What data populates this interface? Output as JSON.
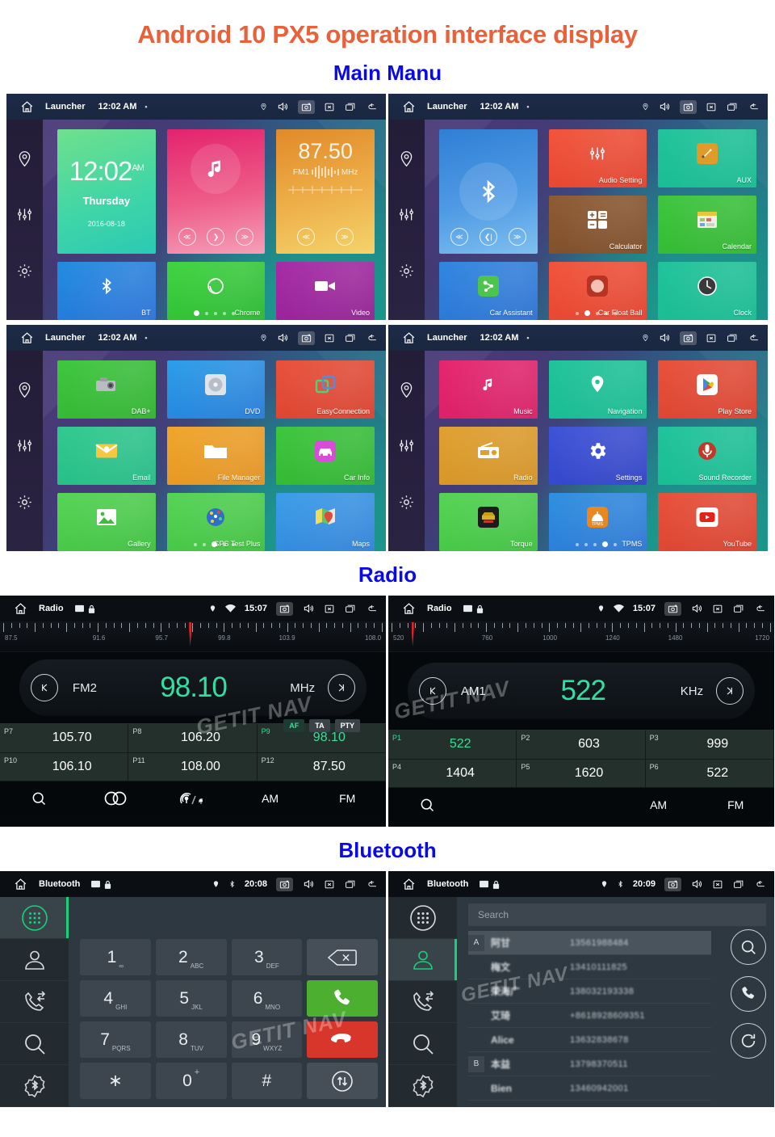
{
  "headings": {
    "main_title": "Android 10 PX5 operation interface display",
    "section_main_menu": "Main Manu",
    "section_radio": "Radio",
    "section_bluetooth": "Bluetooth"
  },
  "watermark": "GETIT NAV",
  "launcher_statusbar": {
    "title": "Launcher",
    "time": "12:02 AM",
    "dot": "•"
  },
  "launcher_panels": [
    {
      "widgets": {
        "clock": {
          "time": "12:02",
          "ampm": "AM",
          "day": "Thursday",
          "date": "2016-08-18"
        },
        "music": {
          "prev": "≪",
          "play": "❯",
          "next": "≫"
        },
        "radio": {
          "freq": "87.50",
          "band": "FM1",
          "unit": "MHz",
          "prev": "≪",
          "next": "≫"
        }
      },
      "tiles": [
        {
          "label": "BT",
          "icon": "bluetooth-icon"
        },
        {
          "label": "Chrome",
          "icon": "chrome-icon"
        },
        {
          "label": "Video",
          "icon": "video-icon"
        }
      ],
      "page_dots": 5,
      "active_dot": 0
    },
    {
      "widgets": {
        "bluetooth": {
          "prev": "≪",
          "play": "❮|",
          "next": "≫"
        }
      },
      "tiles": [
        {
          "label": "Audio Setting",
          "icon": "equalizer-icon"
        },
        {
          "label": "AUX",
          "icon": "aux-icon"
        },
        {
          "label": "Calculator",
          "icon": "calculator-icon"
        },
        {
          "label": "Calendar",
          "icon": "calendar-icon"
        },
        {
          "label": "Car Assistant",
          "icon": "car-assistant-icon"
        },
        {
          "label": "Car Float Ball",
          "icon": "float-ball-icon"
        },
        {
          "label": "Clock",
          "icon": "clock-icon"
        }
      ],
      "page_dots": 5,
      "active_dot": 1
    },
    {
      "tiles": [
        {
          "label": "DAB+",
          "icon": "dab-icon"
        },
        {
          "label": "DVD",
          "icon": "dvd-icon"
        },
        {
          "label": "EasyConnection",
          "icon": "easyconnection-icon"
        },
        {
          "label": "Email",
          "icon": "email-icon"
        },
        {
          "label": "File Manager",
          "icon": "folder-icon"
        },
        {
          "label": "Car Info",
          "icon": "car-info-icon"
        },
        {
          "label": "Gallery",
          "icon": "gallery-icon"
        },
        {
          "label": "GPS Test Plus",
          "icon": "gps-test-icon"
        },
        {
          "label": "Maps",
          "icon": "maps-icon"
        }
      ],
      "page_dots": 5,
      "active_dot": 2
    },
    {
      "tiles": [
        {
          "label": "Music",
          "icon": "music-note-icon"
        },
        {
          "label": "Navigation",
          "icon": "navigation-pin-icon"
        },
        {
          "label": "Play Store",
          "icon": "play-store-icon"
        },
        {
          "label": "Radio",
          "icon": "radio-icon"
        },
        {
          "label": "Settings",
          "icon": "gear-icon"
        },
        {
          "label": "Sound Recorder",
          "icon": "microphone-icon"
        },
        {
          "label": "Torque",
          "icon": "torque-icon"
        },
        {
          "label": "TPMS",
          "icon": "tpms-icon"
        },
        {
          "label": "YouTube",
          "icon": "youtube-icon"
        }
      ],
      "page_dots": 5,
      "active_dot": 3
    }
  ],
  "radio_panels": [
    {
      "statusbar": {
        "title": "Radio",
        "time": "15:07"
      },
      "band": "FM2",
      "value": "98.10",
      "unit": "MHz",
      "scale_labels": [
        "87.5",
        "91.6",
        "95.7",
        "99.8",
        "103.9",
        "108.0"
      ],
      "needle_pct": 49,
      "rds": [
        {
          "label": "AF",
          "active": true
        },
        {
          "label": "TA",
          "active": false
        },
        {
          "label": "PTY",
          "active": false
        }
      ],
      "presets": [
        {
          "id": "P7",
          "value": "105.70",
          "active": false
        },
        {
          "id": "P8",
          "value": "106.20",
          "active": false
        },
        {
          "id": "P9",
          "value": "98.10",
          "active": true
        },
        {
          "id": "P10",
          "value": "106.10",
          "active": false
        },
        {
          "id": "P11",
          "value": "108.00",
          "active": false
        },
        {
          "id": "P12",
          "value": "87.50",
          "active": false
        }
      ],
      "bottom": [
        {
          "label": "",
          "icon": "search-icon"
        },
        {
          "label": "",
          "icon": "stereo-icon"
        },
        {
          "label": "",
          "icon": "local-distance-icon"
        },
        {
          "label": "AM",
          "icon": ""
        },
        {
          "label": "FM",
          "icon": ""
        }
      ]
    },
    {
      "statusbar": {
        "title": "Radio",
        "time": "15:07"
      },
      "band": "AM1",
      "value": "522",
      "unit": "KHz",
      "scale_labels": [
        "520",
        "760",
        "1000",
        "1240",
        "1480",
        "1720"
      ],
      "needle_pct": 6,
      "rds": [],
      "presets": [
        {
          "id": "P1",
          "value": "522",
          "active": true
        },
        {
          "id": "P2",
          "value": "603",
          "active": false
        },
        {
          "id": "P3",
          "value": "999",
          "active": false
        },
        {
          "id": "P4",
          "value": "1404",
          "active": false
        },
        {
          "id": "P5",
          "value": "1620",
          "active": false
        },
        {
          "id": "P6",
          "value": "522",
          "active": false
        }
      ],
      "bottom": [
        {
          "label": "",
          "icon": "search-icon"
        },
        {
          "label": "",
          "icon": ""
        },
        {
          "label": "",
          "icon": ""
        },
        {
          "label": "AM",
          "icon": ""
        },
        {
          "label": "FM",
          "icon": ""
        }
      ]
    }
  ],
  "bluetooth_panels": [
    {
      "statusbar": {
        "title": "Bluetooth",
        "time": "20:08"
      },
      "active_sidebar": 0,
      "sidebar": [
        "dialpad-icon",
        "contacts-icon",
        "call-history-icon",
        "search-icon",
        "bluetooth-settings-icon"
      ],
      "keys": [
        {
          "num": "1",
          "sub": "∞"
        },
        {
          "num": "2",
          "sub": "ABC"
        },
        {
          "num": "3",
          "sub": "DEF"
        },
        {
          "num": "",
          "sub": "",
          "action": "backspace"
        },
        {
          "num": "4",
          "sub": "GHI"
        },
        {
          "num": "5",
          "sub": "JKL"
        },
        {
          "num": "6",
          "sub": "MNO"
        },
        {
          "num": "",
          "sub": "",
          "action": "call"
        },
        {
          "num": "7",
          "sub": "PQRS"
        },
        {
          "num": "8",
          "sub": "TUV"
        },
        {
          "num": "9",
          "sub": "WXYZ"
        },
        {
          "num": "",
          "sub": "",
          "action": "hangup"
        },
        {
          "num": "∗",
          "sub": ""
        },
        {
          "num": "0",
          "sub": "+"
        },
        {
          "num": "#",
          "sub": ""
        },
        {
          "num": "",
          "sub": "",
          "action": "transfer"
        }
      ]
    },
    {
      "statusbar": {
        "title": "Bluetooth",
        "time": "20:09"
      },
      "active_sidebar": 1,
      "sidebar": [
        "dialpad-icon",
        "contacts-icon",
        "call-history-icon",
        "search-icon",
        "bluetooth-settings-icon"
      ],
      "search_placeholder": "Search",
      "contacts": [
        {
          "badge": "A",
          "name": "阿甘",
          "number": "13561988484",
          "selected": true
        },
        {
          "badge": "",
          "name": "梅文",
          "number": "13410111825",
          "selected": false
        },
        {
          "badge": "",
          "name": "荣海广",
          "number": "138032193338",
          "selected": false
        },
        {
          "badge": "",
          "name": "艾琦",
          "number": "+8618928609351",
          "selected": false
        },
        {
          "badge": "",
          "name": "Alice",
          "number": "13632838678",
          "selected": false
        },
        {
          "badge": "B",
          "name": "本益",
          "number": "13798370511",
          "selected": false
        },
        {
          "badge": "",
          "name": "Bien",
          "number": "13460942001",
          "selected": false
        }
      ],
      "actions": [
        "search-icon",
        "call-icon",
        "sync-icon"
      ]
    }
  ]
}
